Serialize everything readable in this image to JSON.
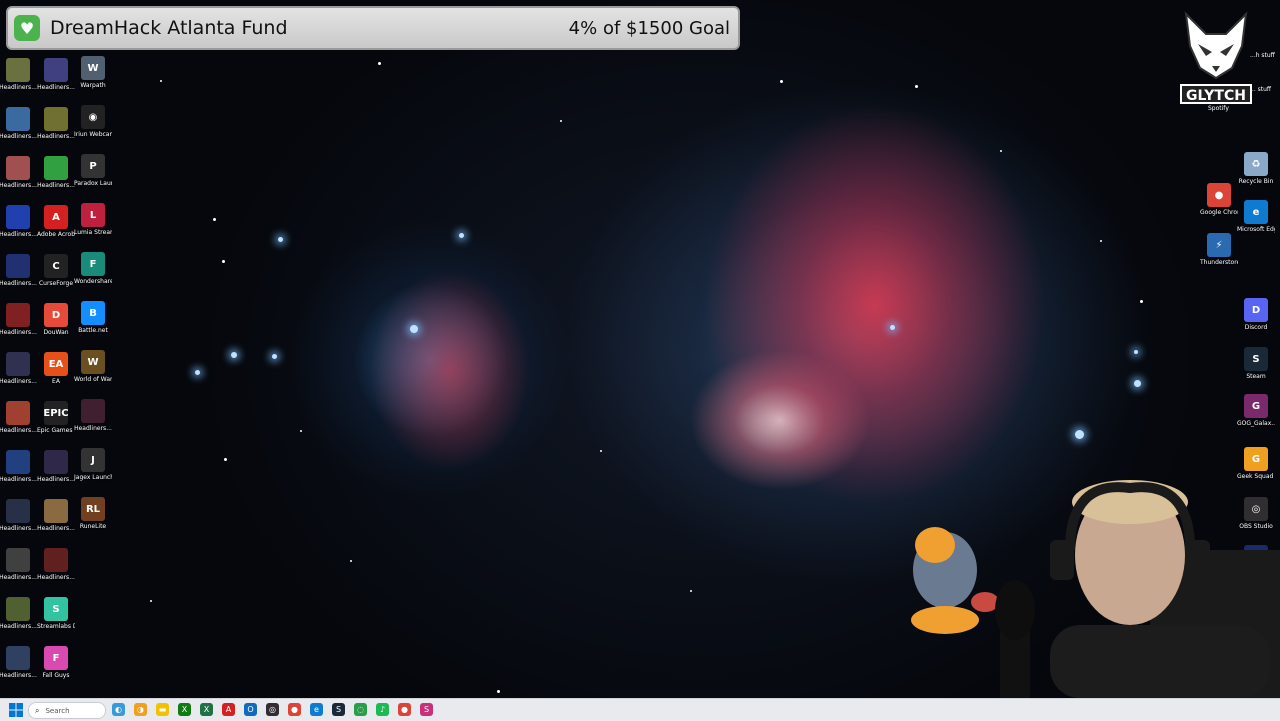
{
  "banner": {
    "title": "DreamHack Atlanta Fund",
    "progress_text": "4% of $1500 Goal",
    "heart_icon": "heart-icon",
    "accent": "#4cb24e"
  },
  "desktop": {
    "left_column_1": [
      {
        "label": "Headliners...",
        "color": "#6a7040"
      },
      {
        "label": "Headliners...",
        "color": "#3a6aa0"
      },
      {
        "label": "Headliners...",
        "color": "#a05050"
      },
      {
        "label": "Headliners...",
        "color": "#2040b0"
      },
      {
        "label": "Headliners...",
        "color": "#203070"
      },
      {
        "label": "Headliners...",
        "color": "#802020"
      },
      {
        "label": "Headliners...",
        "color": "#303050"
      },
      {
        "label": "Headliners...",
        "color": "#a04030"
      },
      {
        "label": "Headliners...",
        "color": "#204080"
      },
      {
        "label": "Headliners...",
        "color": "#283048"
      },
      {
        "label": "Headliners...",
        "color": "#404040"
      },
      {
        "label": "Headliners...",
        "color": "#506030"
      },
      {
        "label": "Headliners...",
        "color": "#304060"
      }
    ],
    "left_column_2": [
      {
        "label": "Headliners...",
        "color": "#404080",
        "glyph": ""
      },
      {
        "label": "Headliners...",
        "color": "#707030",
        "glyph": ""
      },
      {
        "label": "Headliners...",
        "color": "#30a040",
        "glyph": ""
      },
      {
        "label": "Adobe Acrobat",
        "color": "#d42020",
        "glyph": "A"
      },
      {
        "label": "CurseForge",
        "color": "#222222",
        "glyph": "C"
      },
      {
        "label": "DouWan",
        "color": "#e84a3a",
        "glyph": "D"
      },
      {
        "label": "EA",
        "color": "#e8501a",
        "glyph": "EA"
      },
      {
        "label": "Epic Games Launcher",
        "color": "#222222",
        "glyph": "EPIC"
      },
      {
        "label": "Headliners...",
        "color": "#302848",
        "glyph": ""
      },
      {
        "label": "Headliners...",
        "color": "#8a6a40",
        "glyph": ""
      },
      {
        "label": "Headliners...",
        "color": "#602020",
        "glyph": ""
      },
      {
        "label": "Streamlabs Desktop",
        "color": "#31c3a2",
        "glyph": "S"
      },
      {
        "label": "Fall Guys",
        "color": "#d84ab0",
        "glyph": "F"
      }
    ],
    "left_column_3": [
      {
        "label": "Warpath",
        "color": "#506070",
        "glyph": "W"
      },
      {
        "label": "Iriun Webcam",
        "color": "#222222",
        "glyph": "◉"
      },
      {
        "label": "Paradox Launcher v2",
        "color": "#333333",
        "glyph": "P"
      },
      {
        "label": "Lumia Stream",
        "color": "#c02040",
        "glyph": "L"
      },
      {
        "label": "Wondershare Filmora 14",
        "color": "#1a8a7a",
        "glyph": "F"
      },
      {
        "label": "Battle.net",
        "color": "#148eff",
        "glyph": "B"
      },
      {
        "label": "World of Warcraft",
        "color": "#6a5020",
        "glyph": "W"
      },
      {
        "label": "Headliners...",
        "color": "#402030",
        "glyph": ""
      },
      {
        "label": "Jagex Launcher",
        "color": "#333333",
        "glyph": "J"
      },
      {
        "label": "RuneLite",
        "color": "#704020",
        "glyph": "RL"
      }
    ],
    "right_column": [
      {
        "label": "Recycle Bin",
        "color": "#8aa8c8",
        "glyph": "♻"
      },
      {
        "label": "Google Chrome",
        "color": "#db4437",
        "glyph": "●"
      },
      {
        "label": "Microsoft Edge",
        "color": "#0f7bd0",
        "glyph": "e"
      },
      {
        "label": "Thunderstore Mod Mana...",
        "color": "#2a6ab0",
        "glyph": "⚡"
      },
      {
        "label": "Discord",
        "color": "#5865f2",
        "glyph": "D"
      },
      {
        "label": "Steam",
        "color": "#1b2838",
        "glyph": "S"
      },
      {
        "label": "GOG_Galax... - Shortcut",
        "color": "#7a2a6a",
        "glyph": "G"
      },
      {
        "label": "Geek Squad Support.exe",
        "color": "#f0a020",
        "glyph": "G"
      },
      {
        "label": "OBS Studio",
        "color": "#302e31",
        "glyph": "◎"
      },
      {
        "label": "Stream Deck",
        "color": "#1a2a6a",
        "glyph": "▦"
      }
    ],
    "top_right_partial": [
      {
        "label": "...h stuff"
      },
      {
        "label": "... stuff"
      },
      {
        "label": "Spotify"
      }
    ]
  },
  "overlay": {
    "logo_text": "GLYTCH"
  },
  "taskbar": {
    "search_placeholder": "Search",
    "apps": [
      {
        "name": "copilot-icon",
        "color": "#3a9ad9",
        "glyph": "◐"
      },
      {
        "name": "widgets-icon",
        "color": "#f0a020",
        "glyph": "◑"
      },
      {
        "name": "explorer-icon",
        "color": "#f2c200",
        "glyph": "▬"
      },
      {
        "name": "xbox-icon",
        "color": "#107c10",
        "glyph": "X"
      },
      {
        "name": "excel-icon",
        "color": "#1e7145",
        "glyph": "X"
      },
      {
        "name": "acrobat-icon",
        "color": "#d42020",
        "glyph": "A"
      },
      {
        "name": "outlook-icon",
        "color": "#0f6cbd",
        "glyph": "O"
      },
      {
        "name": "obs-icon",
        "color": "#302e31",
        "glyph": "◎"
      },
      {
        "name": "chrome-icon",
        "color": "#db4437",
        "glyph": "●"
      },
      {
        "name": "edge-icon",
        "color": "#0f7bd0",
        "glyph": "e"
      },
      {
        "name": "steam-icon",
        "color": "#1b2838",
        "glyph": "S"
      },
      {
        "name": "browser-icon",
        "color": "#2a9d4a",
        "glyph": "◌"
      },
      {
        "name": "spotify-icon",
        "color": "#1db954",
        "glyph": "♪"
      },
      {
        "name": "chrome-2-icon",
        "color": "#db4437",
        "glyph": "●"
      },
      {
        "name": "streamlabs-icon",
        "color": "#c8307a",
        "glyph": "S"
      }
    ]
  }
}
